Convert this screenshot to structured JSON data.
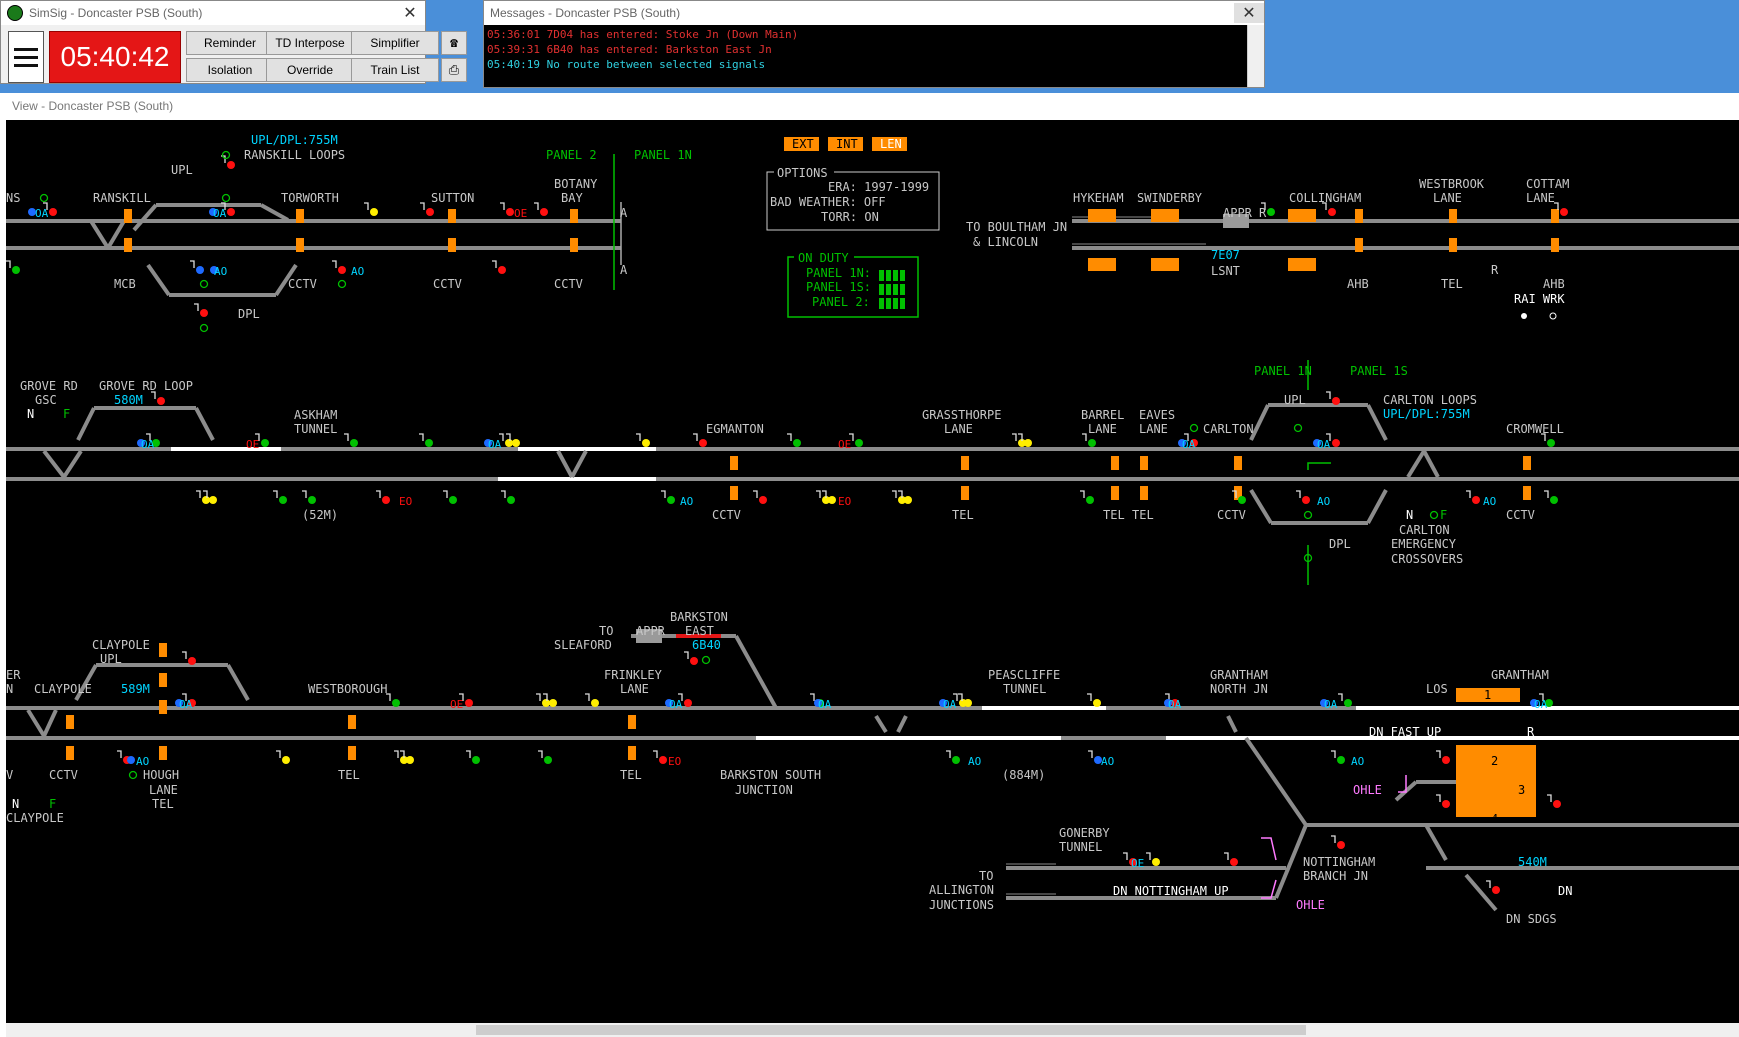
{
  "main_window": {
    "title": "SimSig - Doncaster PSB (South)",
    "clock": "05:40:42",
    "buttons": [
      "Reminder",
      "TD Interpose",
      "Simplifier",
      "Isolation",
      "Override",
      "Train List"
    ],
    "phone_icon": "phone-icon",
    "print_icon": "printer-icon"
  },
  "messages_window": {
    "title": "Messages - Doncaster PSB (South)",
    "lines": [
      {
        "text": "05:36:01 7D04 has entered: Stoke Jn (Down Main)",
        "color": "#e03030"
      },
      {
        "text": "05:39:31 6B40 has entered: Barkston East Jn",
        "color": "#e03030"
      },
      {
        "text": "05:40:19 No route between selected signals",
        "color": "#30d0e0"
      }
    ]
  },
  "view_window": {
    "title": "View - Doncaster PSB (South)"
  },
  "colors": {
    "track": "#8c8c8c",
    "track_set": "#ffffff",
    "track_occupied": "#e41616",
    "orange": "#ff8c00",
    "green": "#00c000",
    "cyan": "#00d4ff",
    "red": "#ff1010",
    "yellow": "#ffee00",
    "blue": "#1e6aff",
    "pink": "#ff7aff",
    "label": "#c8c8c8"
  },
  "labels": {
    "ns": "NS",
    "ranskill": "RANSKILL",
    "mcb1": "MCB",
    "upl_dpl_755m_1": "UPL/DPL:755M",
    "ranskill_loops": "RANSKILL LOOPS",
    "upl1": "UPL",
    "dpl1": "DPL",
    "torworth": "TORWORTH",
    "cctv_t1": "CCTV",
    "sutton": "SUTTON",
    "cctv_s": "CCTV",
    "botany": "BOTANY",
    "bay": "BAY",
    "cctv_b": "CCTV",
    "panel2": "PANEL 2",
    "panel1n": "PANEL 1N",
    "a_top": "A",
    "a_bot": "A",
    "btn_ext": "EXT",
    "btn_int": "INT",
    "btn_len": "LEN",
    "options": "OPTIONS",
    "era": "ERA: 1997-1999",
    "bad_weather": "BAD WEATHER: OFF",
    "torr": "TORR: ON",
    "on_duty": "ON DUTY",
    "panel_1n": "PANEL 1N:",
    "panel_1s": "PANEL 1S:",
    "panel_2": "PANEL 2:",
    "hykeham": "HYKEHAM",
    "swinderby": "SWINDERBY",
    "appr1": "APPR",
    "collingham": "COLLINGHAM",
    "westbrook": "WESTBROOK",
    "lane_w": "LANE",
    "cottam": "COTTAM",
    "lane_c": "LANE",
    "to_boultham": "TO BOULTHAM JN",
    "and_lincoln": "& LINCOLN",
    "td_7e07": "7E07",
    "lsnt": "LSNT",
    "ahb1": "AHB",
    "tel_w": "TEL",
    "ahb2": "AHB",
    "rai_wrk": "RAI WRK",
    "r1": "R",
    "r2": "R",
    "grove_rd": "GROVE RD",
    "gsc": "GSC",
    "no_f1": "N",
    "f1": "F",
    "grove_rd_loop": "GROVE RD LOOP",
    "len_580m": "580M",
    "askham": "ASKHAM",
    "tunnel_a": "TUNNEL",
    "len_52m": "(52M)",
    "egmanton": "EGMANTON",
    "cctv_e": "CCTV",
    "grassthorpe": "GRASSTHORPE",
    "lane_g": "LANE",
    "tel_g": "TEL",
    "barrel": "BARREL",
    "lane_br": "LANE",
    "eaves": "EAVES",
    "lane_ev": "LANE",
    "tel_b1": "TEL",
    "tel_b2": "TEL",
    "carlton": "CARLTON",
    "cctv_cl": "CCTV",
    "panel1n_b": "PANEL 1N",
    "panel1s": "PANEL 1S",
    "upl2": "UPL",
    "dpl2": "DPL",
    "carlton_loops": "CARLTON LOOPS",
    "upl_dpl_755m_2": "UPL/DPL:755M",
    "cromwell": "CROMWELL",
    "cctv_cr": "CCTV",
    "no_f2": "N",
    "f2": "F",
    "carlton_em": "CARLTON",
    "emergency": "EMERGENCY",
    "crossovers": "CROSSOVERS",
    "er": "ER",
    "n_left": "N",
    "claypole1": "CLAYPOLE",
    "cctv_cp": "CCTV",
    "claypole_upl": "CLAYPOLE",
    "upl3": "UPL",
    "len_589m": "589M",
    "hough": "HOUGH",
    "lane_h": "LANE",
    "tel_h": "TEL",
    "v_left": "V",
    "no_f3": "N",
    "f3": "F",
    "claypole2": "CLAYPOLE",
    "westborough": "WESTBOROUGH",
    "tel_wb": "TEL",
    "frinkley": "FRINKLEY",
    "lane_f": "LANE",
    "tel_f": "TEL",
    "to_sleaford_to": "TO",
    "sleaford": "SLEAFORD",
    "appr2": "APPR",
    "barkston": "BARKSTON",
    "east": "EAST",
    "td_6b40": "6B40",
    "barkston_south": "BARKSTON SOUTH",
    "junction": "JUNCTION",
    "peascliffe": "PEASCLIFFE",
    "tunnel_p": "TUNNEL",
    "len_884m": "(884M)",
    "grantham_north": "GRANTHAM",
    "north_jn": "NORTH JN",
    "grantham": "GRANTHAM",
    "los": "LOS",
    "plat1": "1",
    "dn_fast_up": "DN FAST UP",
    "r3": "R",
    "plat2": "2",
    "plat3": "3",
    "plat4": "4",
    "ohle1": "OHLE",
    "ohle2": "OHLE",
    "gonerby": "GONERBY",
    "tunnel_gn": "TUNNEL",
    "to_allington": "TO",
    "allington": "ALLINGTON",
    "junctions": "JUNCTIONS",
    "dn_nottingham_up": "DN NOTTINGHAM UP",
    "nottingham": "NOTTINGHAM",
    "branch_jn": "BRANCH JN",
    "len_540m": "540M",
    "dn_right": "DN",
    "dn_sdgs": "DN SDGS",
    "oa": "OA",
    "ao": "AO",
    "oe": "OE",
    "eo": "EO"
  }
}
